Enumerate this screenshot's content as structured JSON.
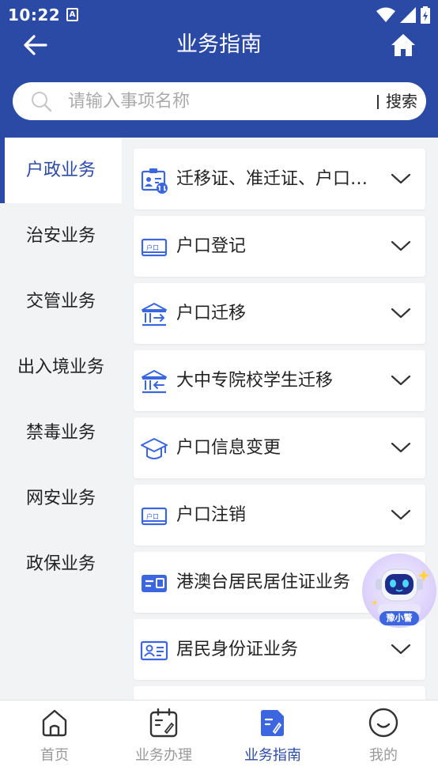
{
  "status_bar": {
    "time": "10:22",
    "notification_icon": "A"
  },
  "nav": {
    "title": "业务指南"
  },
  "search": {
    "placeholder": "请输入事项名称",
    "button_label": "搜索"
  },
  "sidebar": {
    "items": [
      {
        "label": "户政业务",
        "active": true
      },
      {
        "label": "治安业务",
        "active": false
      },
      {
        "label": "交管业务",
        "active": false
      },
      {
        "label": "出入境业务",
        "active": false
      },
      {
        "label": "禁毒业务",
        "active": false
      },
      {
        "label": "网安业务",
        "active": false
      },
      {
        "label": "政保业务",
        "active": false
      }
    ]
  },
  "cards": [
    {
      "label": "迁移证、准迁证、户口登记",
      "icon": "id-card-transfer-icon",
      "chevron": true
    },
    {
      "label": "户口登记",
      "icon": "hukou-card-icon",
      "chevron": true
    },
    {
      "label": "户口迁移",
      "icon": "building-transfer-icon",
      "chevron": true
    },
    {
      "label": "大中专院校学生迁移",
      "icon": "building-transfer-icon",
      "chevron": true
    },
    {
      "label": "户口信息变更",
      "icon": "graduation-cap-icon",
      "chevron": true
    },
    {
      "label": "户口注销",
      "icon": "hukou-card-icon",
      "chevron": true
    },
    {
      "label": "港澳台居民居住证业务",
      "icon": "residence-card-icon",
      "chevron": false
    },
    {
      "label": "居民身份证业务",
      "icon": "id-card-icon",
      "chevron": true
    }
  ],
  "assistant": {
    "label": "豫小警"
  },
  "tabbar": {
    "items": [
      {
        "label": "首页",
        "active": false
      },
      {
        "label": "业务办理",
        "active": false
      },
      {
        "label": "业务指南",
        "active": true
      },
      {
        "label": "我的",
        "active": false
      }
    ]
  },
  "colors": {
    "brand": "#2b4aa5",
    "accent": "#3c66e0",
    "inactive": "#999999"
  }
}
